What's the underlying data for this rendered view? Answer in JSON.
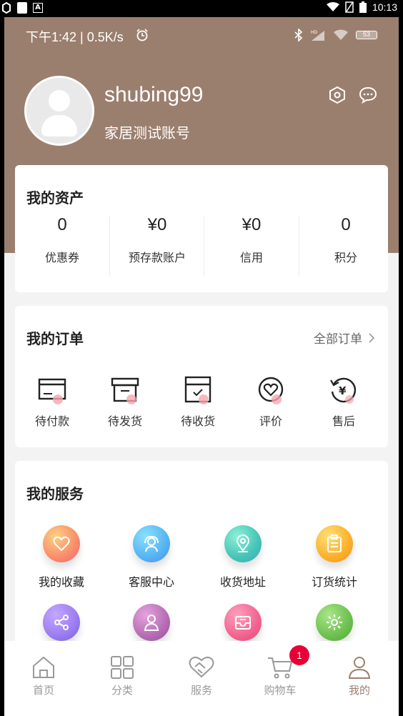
{
  "system_bar": {
    "time": "10:13"
  },
  "inner_status": {
    "time": "下午1:42 | 0.5K/s",
    "battery": "53"
  },
  "profile": {
    "username": "shubing99",
    "subtitle": "家居测试账号"
  },
  "assets": {
    "title": "我的资产",
    "items": [
      {
        "value": "0",
        "label": "优惠券"
      },
      {
        "value": "¥0",
        "label": "预存款账户"
      },
      {
        "value": "¥0",
        "label": "信用"
      },
      {
        "value": "0",
        "label": "积分"
      }
    ]
  },
  "orders": {
    "title": "我的订单",
    "all_label": "全部订单",
    "items": [
      {
        "label": "待付款",
        "icon": "wallet-icon"
      },
      {
        "label": "待发货",
        "icon": "box-icon"
      },
      {
        "label": "待收货",
        "icon": "delivery-box-icon"
      },
      {
        "label": "评价",
        "icon": "heart-chat-icon"
      },
      {
        "label": "售后",
        "icon": "refund-icon"
      }
    ]
  },
  "services": {
    "title": "我的服务",
    "items": [
      {
        "label": "我的收藏",
        "icon": "heart-icon",
        "color": "#f98c6a"
      },
      {
        "label": "客服中心",
        "icon": "headset-icon",
        "color": "#55b4f2"
      },
      {
        "label": "收货地址",
        "icon": "location-pin-icon",
        "color": "#45c4b5"
      },
      {
        "label": "订货统计",
        "icon": "clipboard-icon",
        "color": "#fbb02a"
      },
      {
        "label": "",
        "icon": "share-icon",
        "color": "#9a7cf0"
      },
      {
        "label": "",
        "icon": "person-card-icon",
        "color": "#b56cb5"
      },
      {
        "label": "",
        "icon": "inbox-icon",
        "color": "#f2638f"
      },
      {
        "label": "",
        "icon": "gear-icon",
        "color": "#6dc04e"
      }
    ]
  },
  "tabbar": {
    "items": [
      {
        "label": "首页",
        "icon": "home-icon"
      },
      {
        "label": "分类",
        "icon": "grid-icon"
      },
      {
        "label": "服务",
        "icon": "handshake-icon"
      },
      {
        "label": "购物车",
        "icon": "cart-icon",
        "badge": "1"
      },
      {
        "label": "我的",
        "icon": "user-icon",
        "active": true
      }
    ]
  },
  "colors": {
    "header": "#9b7f6e",
    "badge": "#e60033",
    "background": "#f3f3f3"
  }
}
